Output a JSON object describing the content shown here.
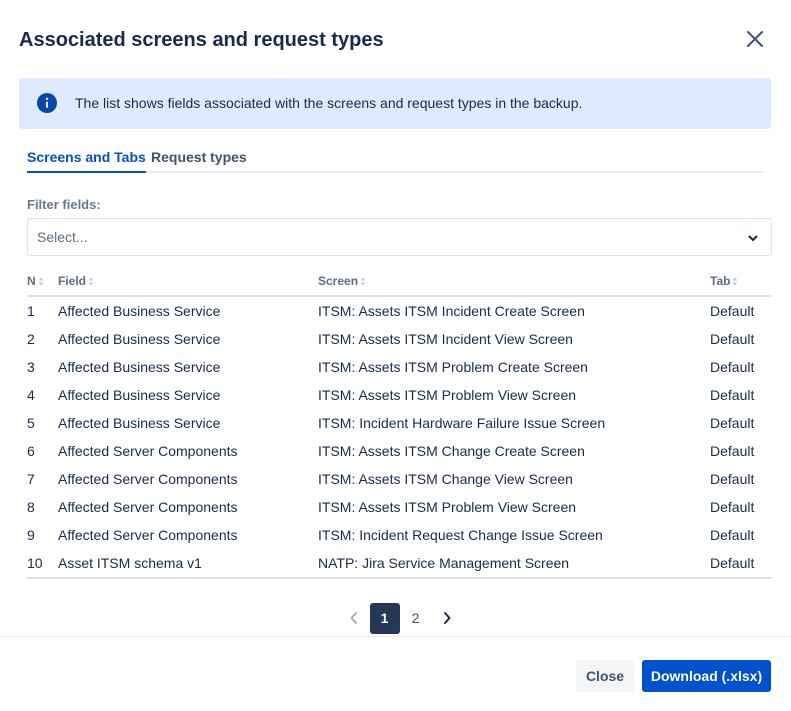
{
  "dialog": {
    "title": "Associated screens and request types",
    "close_icon": "close-icon"
  },
  "banner": {
    "icon": "info-icon",
    "text": "The list shows fields associated with the screens and request types in the backup.",
    "accent_color": "#0052CC",
    "background_color": "#DEEBFF"
  },
  "tabs": [
    {
      "label": "Screens and Tabs",
      "active": true
    },
    {
      "label": "Request types",
      "active": false
    }
  ],
  "filter": {
    "label": "Filter fields:",
    "placeholder": "Select..."
  },
  "table": {
    "columns": [
      "N",
      "Field",
      "Screen",
      "Tab"
    ],
    "rows": [
      {
        "n": "1",
        "field": "Affected Business Service",
        "screen": "ITSM: Assets ITSM Incident Create Screen",
        "tab": "Default"
      },
      {
        "n": "2",
        "field": "Affected Business Service",
        "screen": "ITSM: Assets ITSM Incident View Screen",
        "tab": "Default"
      },
      {
        "n": "3",
        "field": "Affected Business Service",
        "screen": "ITSM: Assets ITSM Problem Create Screen",
        "tab": "Default"
      },
      {
        "n": "4",
        "field": "Affected Business Service",
        "screen": "ITSM: Assets ITSM Problem View Screen",
        "tab": "Default"
      },
      {
        "n": "5",
        "field": "Affected Business Service",
        "screen": "ITSM: Incident Hardware Failure Issue Screen",
        "tab": "Default"
      },
      {
        "n": "6",
        "field": "Affected Server Components",
        "screen": "ITSM: Assets ITSM Change Create Screen",
        "tab": "Default"
      },
      {
        "n": "7",
        "field": "Affected Server Components",
        "screen": "ITSM: Assets ITSM Change View Screen",
        "tab": "Default"
      },
      {
        "n": "8",
        "field": "Affected Server Components",
        "screen": "ITSM: Assets ITSM Problem View Screen",
        "tab": "Default"
      },
      {
        "n": "9",
        "field": "Affected Server Components",
        "screen": "ITSM: Incident Request Change Issue Screen",
        "tab": "Default"
      },
      {
        "n": "10",
        "field": "Asset ITSM schema v1",
        "screen": "NATP: Jira Service Management Screen",
        "tab": "Default"
      }
    ]
  },
  "pagination": {
    "pages": [
      "1",
      "2"
    ],
    "current": "1"
  },
  "footer": {
    "close_label": "Close",
    "download_label": "Download (.xlsx)",
    "primary_color": "#0052CC"
  }
}
